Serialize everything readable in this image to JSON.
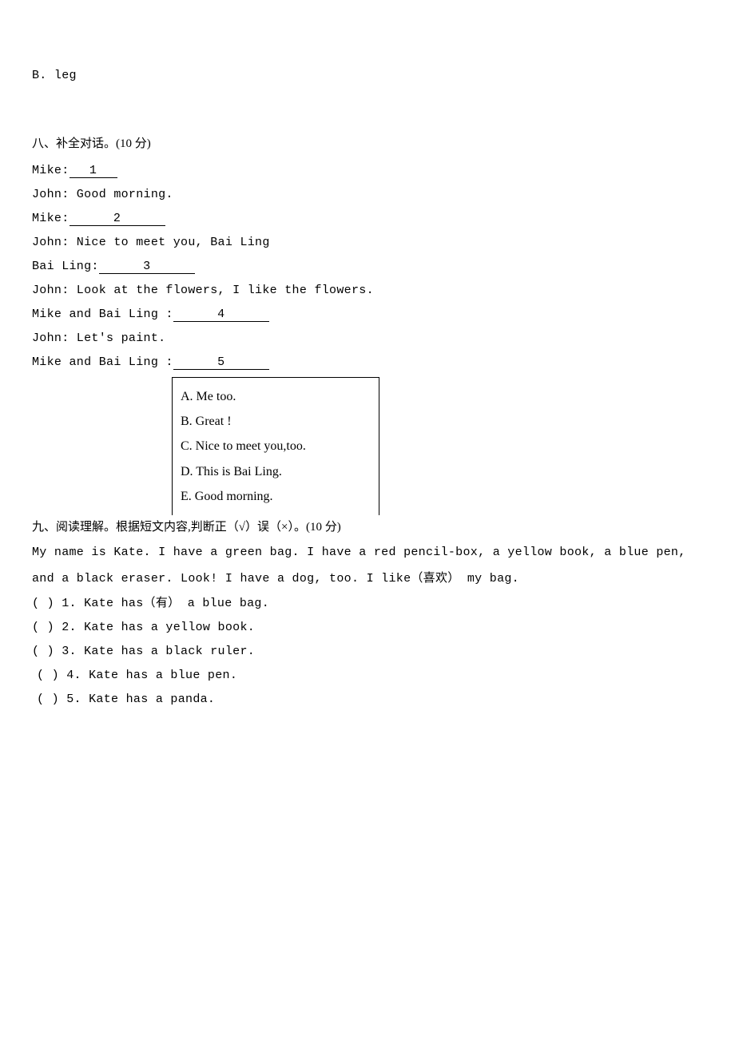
{
  "top_option": "B. leg",
  "section8": {
    "title": "八、补全对话。(10 分)",
    "lines": {
      "l1_pre": "Mike:",
      "l1_blank": "1",
      "l2": "John: Good morning.",
      "l3_pre": "Mike:",
      "l3_blank": "2",
      "l4": "John: Nice to meet you, Bai Ling",
      "l5_pre": "Bai Ling:",
      "l5_blank": "3",
      "l6": "John: Look at the  flowers, I  like the flowers.",
      "l7_pre": "Mike and Bai Ling :",
      "l7_blank": "4",
      "l8": "John: Let's paint.",
      "l9_pre": "Mike and Bai Ling :",
      "l9_blank": "5"
    },
    "options": {
      "a": "A. Me too.",
      "b": "B. Great !",
      "c": "C. Nice to meet you,too.",
      "d": "D. This is Bai Ling.",
      "e": "E. Good morning."
    }
  },
  "section9": {
    "title": "九、阅读理解。根据短文内容,判断正（√）误（×）。(10 分)",
    "passage": "My name is Kate. I have a green bag. I have a red pencil-box, a yellow book, a blue pen, and a black eraser. Look! I have a dog, too. I like（喜欢） my bag.",
    "q1": "(    ) 1. Kate has（有） a blue bag.",
    "q2": "(    ) 2. Kate has a yellow book.",
    "q3": "(    ) 3. Kate has a black ruler.",
    "q4": "(    ) 4. Kate has a blue pen.",
    "q5": "(    ) 5. Kate has a panda."
  }
}
